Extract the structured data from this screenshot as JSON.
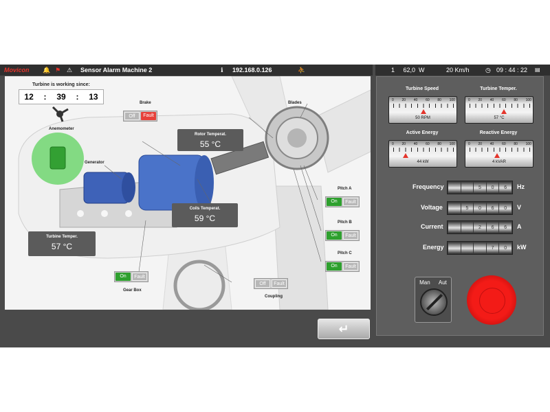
{
  "topbar": {
    "logo": "Movicon",
    "machine_title": "Sensor Alarm Machine 2",
    "ip": "192.168.0.126",
    "power": "1     62,0  W",
    "wind": "20  Km/h",
    "time": "09 : 44 : 22",
    "icons": [
      "bell-icon",
      "red-flag-icon",
      "warning-icon",
      "info-icon",
      "person-icon",
      "clock-icon",
      "us-flag-icon"
    ]
  },
  "diagram": {
    "working_since_label": "Turbine is working since:",
    "working_since": [
      "12",
      ":",
      "39",
      ":",
      "13"
    ],
    "anemometer_label": "Anemometer",
    "generator_label": "Generator",
    "brake": {
      "label": "Brake",
      "off": "Off",
      "fault": "Fault"
    },
    "rotor_temp": {
      "label": "Rotor Temperat.",
      "value": "55 °C"
    },
    "coils_temp": {
      "label": "Coils Temperat.",
      "value": "59 °C"
    },
    "turbine_temp": {
      "label": "Turbine Temper.",
      "value": "57 °C"
    },
    "blades_label": "Blades",
    "pitch_a": {
      "label": "Pitch  A",
      "on": "On",
      "fault": "Fault"
    },
    "pitch_b": {
      "label": "Pitch  B",
      "on": "On",
      "fault": "Fault"
    },
    "pitch_c": {
      "label": "Pitch  C",
      "on": "On",
      "fault": "Fault"
    },
    "gearbox": {
      "label": "Gear Box",
      "on": "On",
      "fault": "Fault"
    },
    "coupling": {
      "label": "Coupling",
      "off": "Off",
      "fault": "Fault"
    }
  },
  "gauges": {
    "scale": [
      "0",
      "20",
      "40",
      "60",
      "80",
      "100"
    ],
    "turbine_speed": {
      "label": "Turbine Speed",
      "value": "50 RPM",
      "level": 0.5
    },
    "turbine_temper": {
      "label": "Turbine Temper.",
      "value": "57 °C",
      "level": 0.57
    },
    "active_energy": {
      "label": "Active Energy",
      "value": "44 kW",
      "level": 0.2
    },
    "reactive_energy": {
      "label": "Reactive Energy",
      "value": "4 kVAR",
      "level": 0.45
    }
  },
  "measurements": {
    "frequency": {
      "label": "Frequency",
      "digits": [
        "",
        "",
        "5",
        "0",
        "6"
      ],
      "unit": "Hz"
    },
    "voltage": {
      "label": "Voltage",
      "digits": [
        "",
        "5",
        "0",
        "6",
        "0"
      ],
      "unit": "V"
    },
    "current": {
      "label": "Current",
      "digits": [
        "",
        "",
        "2",
        "6",
        "6"
      ],
      "unit": "A"
    },
    "energy": {
      "label": "Energy",
      "digits": [
        "",
        "",
        "",
        "7",
        "0"
      ],
      "unit": "kW"
    }
  },
  "controls": {
    "man_label": "Man",
    "aut_label": "Aut",
    "back_symbol": "↵"
  },
  "colors": {
    "brand_red": "#e4342b",
    "on_green": "#2ea02e",
    "fault_red": "#e6413a",
    "estop_red": "#f31b17"
  }
}
